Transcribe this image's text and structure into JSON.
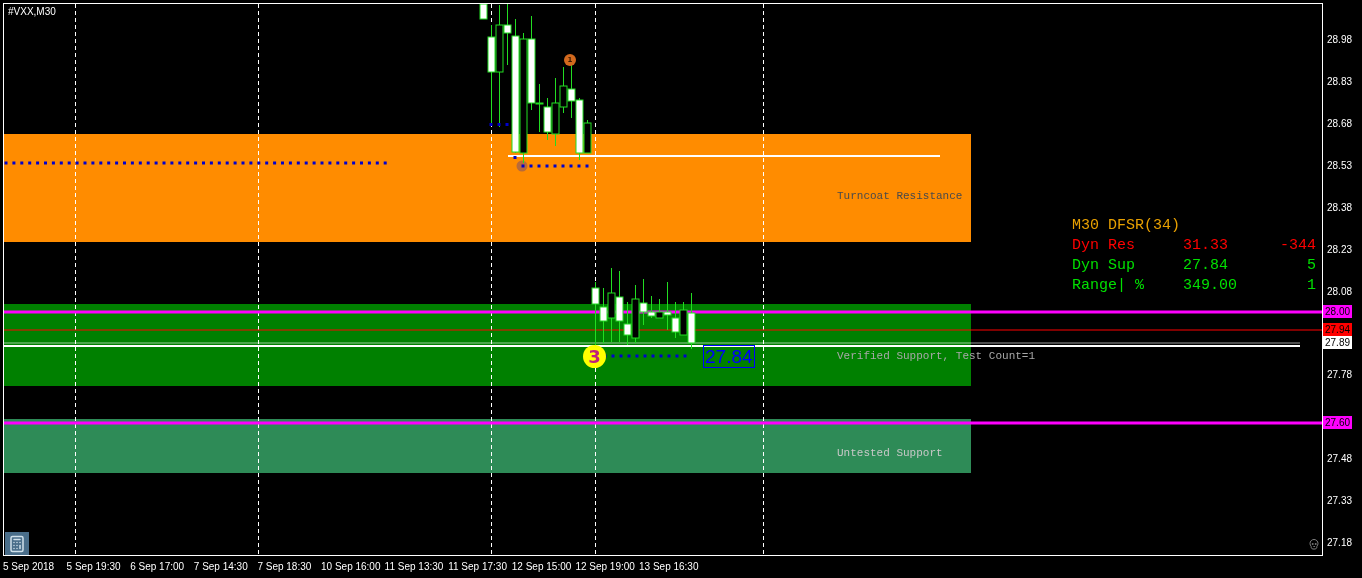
{
  "chart": {
    "title": "#VXX,M30"
  },
  "zones": [
    {
      "label": "Turncoat Resistance",
      "color": "#ff8c00"
    },
    {
      "label": "Verified Support, Test Count=1",
      "color": "#008000"
    },
    {
      "label": "Untested Support",
      "color": "#2e8b57"
    }
  ],
  "info_panel": {
    "title": "M30 DFSR(34)",
    "rows": [
      {
        "label": "Dyn Res",
        "value": "31.33",
        "count": "-344",
        "color": "#ff0000"
      },
      {
        "label": "Dyn Sup",
        "value": "27.84",
        "count": "5",
        "color": "#00e000"
      },
      {
        "label": "Range| %",
        "value": "349.00",
        "count": "1",
        "color": "#00e000"
      }
    ]
  },
  "badges": [
    {
      "text": "1",
      "color": "#d2691e"
    },
    {
      "text": "3",
      "color": "#ffff00"
    }
  ],
  "price_tag": "27.84",
  "price_axis": {
    "ticks": [
      "28.98",
      "28.83",
      "28.68",
      "28.53",
      "28.38",
      "28.23",
      "28.08",
      "27.78",
      "27.48",
      "27.33",
      "27.18"
    ],
    "markers": [
      {
        "text": "28.00",
        "color": "#ff00ff"
      },
      {
        "text": "27.94",
        "color": "#ff0000"
      },
      {
        "text": "27.89",
        "color": "#ffffff"
      },
      {
        "text": "27.60",
        "color": "#ff00ff"
      }
    ]
  },
  "time_axis": [
    "5 Sep 2018",
    "5 Sep 19:30",
    "6 Sep 17:00",
    "7 Sep 14:30",
    "7 Sep 18:30",
    "10 Sep 16:00",
    "11 Sep 13:30",
    "11 Sep 17:30",
    "12 Sep 15:00",
    "12 Sep 19:00",
    "13 Sep 16:30"
  ]
}
